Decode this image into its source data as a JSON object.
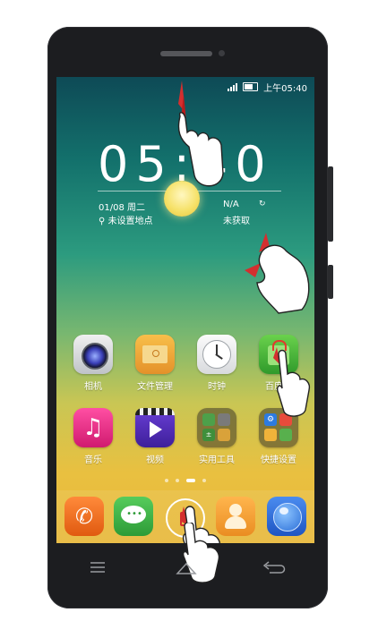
{
  "status": {
    "time": "上午05:40"
  },
  "lockclock": {
    "time": "05:40",
    "date": "01/08",
    "weekday": "周二",
    "location": "未设置地点",
    "temperature": "N/A",
    "weather_status": "未获取"
  },
  "apps": [
    {
      "label": "相机",
      "icon": "camera-icon"
    },
    {
      "label": "文件管理",
      "icon": "folder-icon"
    },
    {
      "label": "时钟",
      "icon": "clock-icon"
    },
    {
      "label": "百度手",
      "icon": "baidu-bag-icon"
    },
    {
      "label": "音乐",
      "icon": "music-icon"
    },
    {
      "label": "视频",
      "icon": "video-icon"
    },
    {
      "label": "实用工具",
      "icon": "tools-folder-icon"
    },
    {
      "label": "快捷设置",
      "icon": "settings-folder-icon"
    }
  ],
  "dock": [
    {
      "icon": "phone-icon"
    },
    {
      "icon": "messages-icon"
    },
    {
      "icon": "app-drawer-icon"
    },
    {
      "icon": "contacts-icon"
    },
    {
      "icon": "browser-globe-icon"
    }
  ],
  "nav": {
    "menu": "menu-icon",
    "home": "home-icon",
    "back": "back-icon"
  },
  "colors": {
    "accent_red": "#d32f2f",
    "dock_phone": "#f26a1b",
    "dock_message": "#3cb14a",
    "dock_contacts": "#f2a23a",
    "dock_browser": "#2f6fd8"
  }
}
